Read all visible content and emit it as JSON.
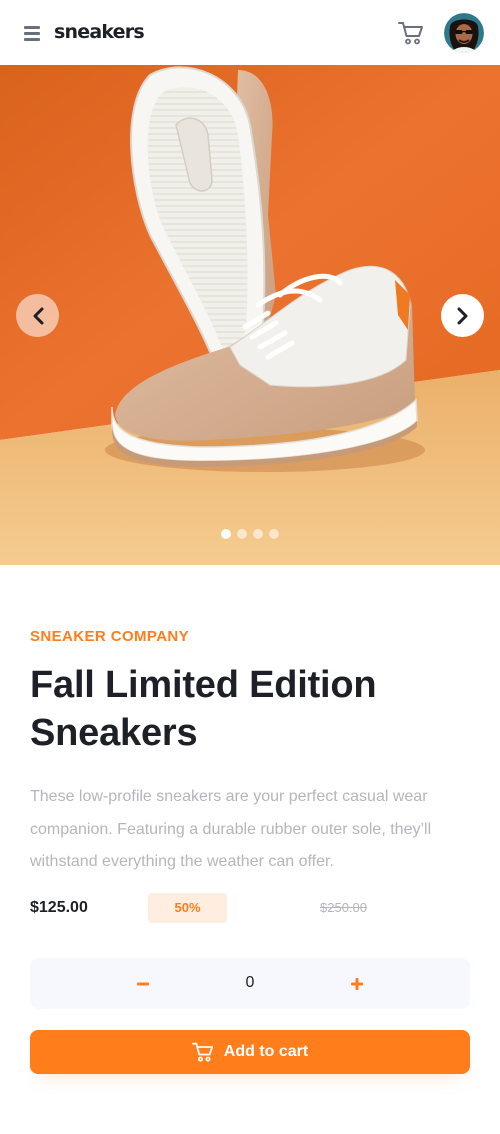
{
  "header": {
    "logo": "sneakers",
    "menu_icon": "hamburger-menu-icon",
    "cart_icon": "cart-icon"
  },
  "gallery": {
    "prev_icon": "chevron-left-icon",
    "next_icon": "chevron-right-icon",
    "slides": 4,
    "active_slide": 1,
    "colors": {
      "orange_wall": "#E56A1E",
      "floor": "#F2C37F"
    }
  },
  "product": {
    "company": "SNEAKER COMPANY",
    "title": "Fall Limited Edition Sneakers",
    "description": "These low-profile sneakers are your perfect casual wear companion. Featuring a durable rubber outer sole, they’ll withstand everything the weather can offer.",
    "price": "$125.00",
    "discount": "50%",
    "old_price": "$250.00"
  },
  "quantity": {
    "value": "0",
    "minus_label": "−",
    "plus_label": "+"
  },
  "cart_button": {
    "label": "Add to cart"
  },
  "colors": {
    "accent": "#FF7E1B",
    "accent_pale": "#FFEDE0",
    "dark_text": "#1D2026",
    "muted_text": "#B3B6BD",
    "light_bg": "#F6F8FD"
  }
}
